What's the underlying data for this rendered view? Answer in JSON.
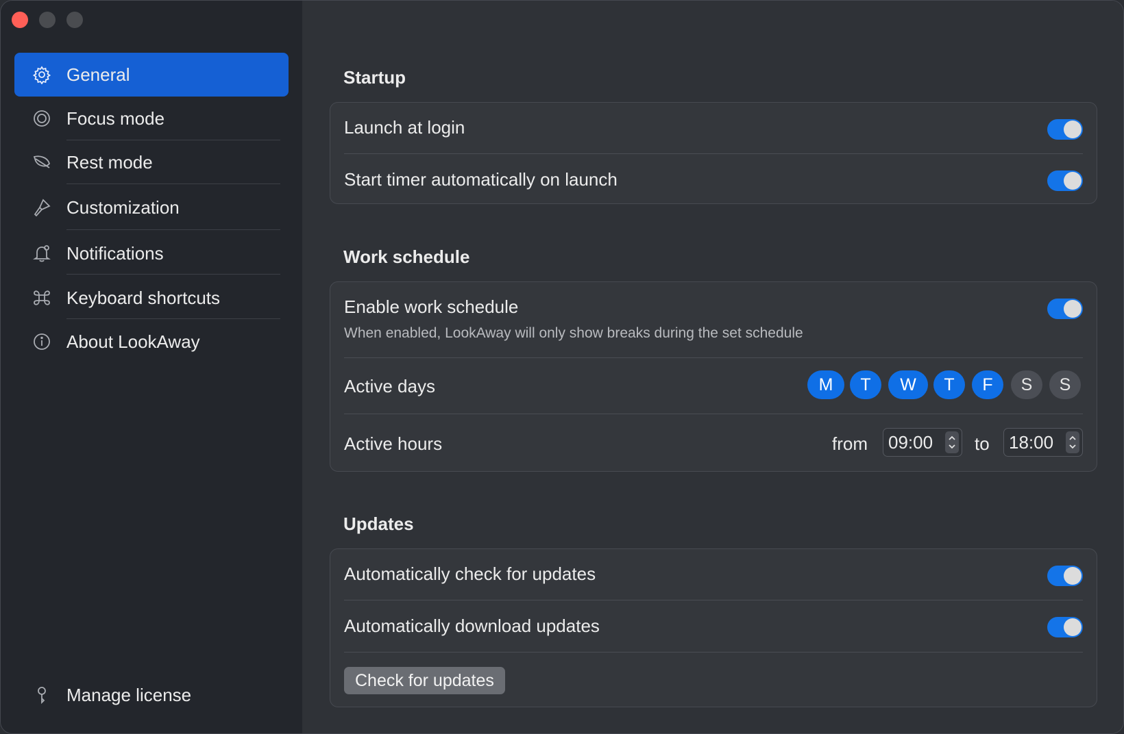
{
  "window": {
    "traffic_lights": [
      "close",
      "minimize",
      "maximize"
    ]
  },
  "sidebar": {
    "items": [
      {
        "label": "General",
        "icon": "gear-icon",
        "active": true
      },
      {
        "label": "Focus mode",
        "icon": "target-icon",
        "active": false
      },
      {
        "label": "Rest mode",
        "icon": "leaf-icon",
        "active": false
      },
      {
        "label": "Customization",
        "icon": "paintbrush-icon",
        "active": false
      },
      {
        "label": "Notifications",
        "icon": "bell-icon",
        "active": false
      },
      {
        "label": "Keyboard shortcuts",
        "icon": "command-icon",
        "active": false
      },
      {
        "label": "About LookAway",
        "icon": "info-icon",
        "active": false
      }
    ],
    "footer": {
      "label": "Manage license",
      "icon": "key-icon"
    }
  },
  "startup": {
    "title": "Startup",
    "launch_at_login": {
      "label": "Launch at login",
      "enabled": true
    },
    "start_timer": {
      "label": "Start timer automatically on launch",
      "enabled": true
    }
  },
  "work_schedule": {
    "title": "Work schedule",
    "enable": {
      "label": "Enable work schedule",
      "description": "When enabled, LookAway will only show breaks during the set schedule",
      "enabled": true
    },
    "active_days": {
      "label": "Active days",
      "days": [
        {
          "letter": "M",
          "on": true
        },
        {
          "letter": "T",
          "on": true
        },
        {
          "letter": "W",
          "on": true
        },
        {
          "letter": "T",
          "on": true
        },
        {
          "letter": "F",
          "on": true
        },
        {
          "letter": "S",
          "on": false
        },
        {
          "letter": "S",
          "on": false
        }
      ]
    },
    "active_hours": {
      "label": "Active hours",
      "from_label": "from",
      "from": "09:00",
      "to_label": "to",
      "to": "18:00"
    }
  },
  "updates": {
    "title": "Updates",
    "auto_check": {
      "label": "Automatically check for updates",
      "enabled": true
    },
    "auto_download": {
      "label": "Automatically download updates",
      "enabled": true
    },
    "check_button": "Check for updates"
  },
  "colors": {
    "accent": "#1474e8",
    "sidebar_active": "#1560d4",
    "close": "#ff5f57"
  }
}
